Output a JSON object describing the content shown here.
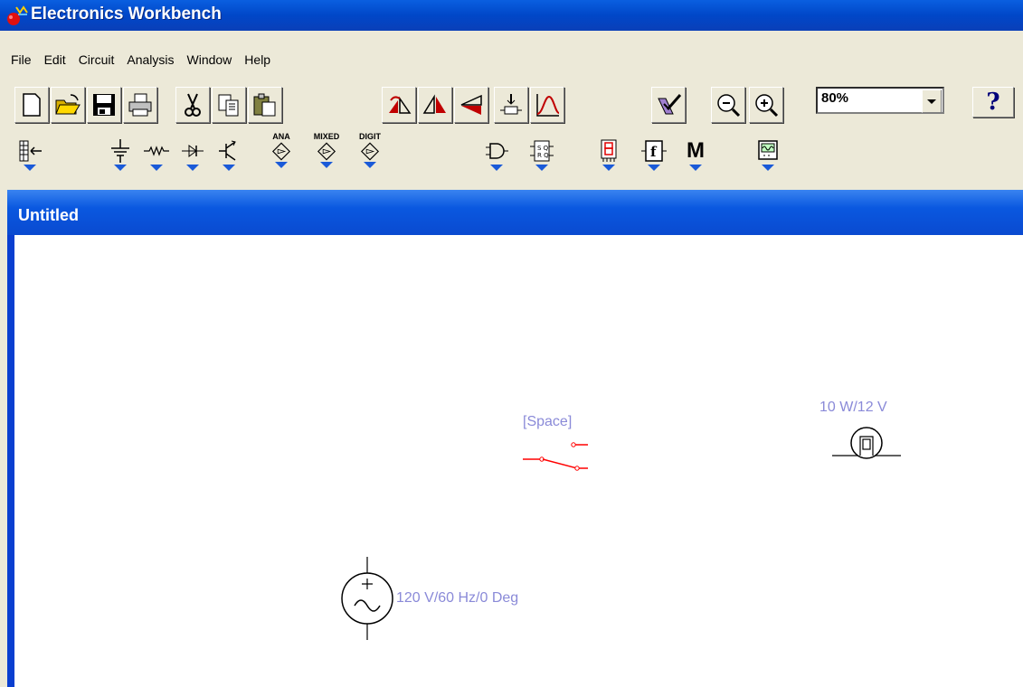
{
  "window": {
    "title": "Electronics Workbench"
  },
  "menu": [
    "File",
    "Edit",
    "Circuit",
    "Analysis",
    "Window",
    "Help"
  ],
  "toolbar": {
    "zoom_value": "80%",
    "help_label": "?"
  },
  "parts_toolbar": {
    "analog_label": "ANA",
    "mixed_label": "MIXED",
    "digital_label": "DIGIT",
    "m_label": "M"
  },
  "document": {
    "title": "Untitled"
  },
  "circuit": {
    "switch_label": "[Space]",
    "lamp_label": "10 W/12 V",
    "source_label": "120 V/60 Hz/0 Deg"
  },
  "colors": {
    "titlebar": "#0047c8",
    "wire": "#000000",
    "switch": "#ff0000",
    "label": "#8a8ad8"
  }
}
